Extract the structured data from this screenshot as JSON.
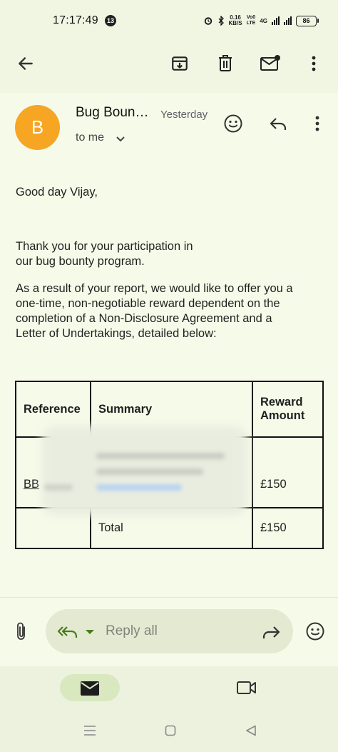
{
  "status_bar": {
    "time": "17:17:49",
    "notification_count": "13",
    "net_speed_value": "0.16",
    "net_speed_unit": "KB/S",
    "volte_top": "Vo0",
    "volte_bottom": "LTE",
    "network_type": "4G",
    "battery_level": "86"
  },
  "toolbar": {
    "back_icon": "arrow-left-icon",
    "archive_icon": "archive-icon",
    "delete_icon": "trash-icon",
    "mark_unread_icon": "mail-unread-icon",
    "more_icon": "more-vertical-icon"
  },
  "email": {
    "avatar_letter": "B",
    "avatar_color": "#f6a623",
    "sender": "Bug Boun…",
    "date": "Yesterday",
    "recipient": "to me",
    "greeting": "Good day Vijay,",
    "paragraph1_line1": "Thank you for your participation in",
    "paragraph1_line2": "our bug bounty program.",
    "paragraph2_line1": "As a result of your report, we would like to offer you a",
    "paragraph2_line2": "one-time, non-negotiable reward dependent on the",
    "paragraph2_line3": "completion of a Non-Disclosure Agreement and a",
    "paragraph2_line4": "Letter of Undertakings, detailed below:"
  },
  "table": {
    "headers": {
      "reference": "Reference",
      "summary": "Summary",
      "reward_line1": "Reward",
      "reward_line2": "Amount"
    },
    "rows": [
      {
        "reference": "BB",
        "summary": "",
        "reward": "£150"
      },
      {
        "reference": "",
        "summary": "Total",
        "reward": "£150"
      }
    ]
  },
  "reply_bar": {
    "placeholder": "Reply all"
  },
  "colors": {
    "background": "#f6fbe9",
    "accent_green": "#4a7c1f",
    "reply_pill": "#e4ead2"
  }
}
